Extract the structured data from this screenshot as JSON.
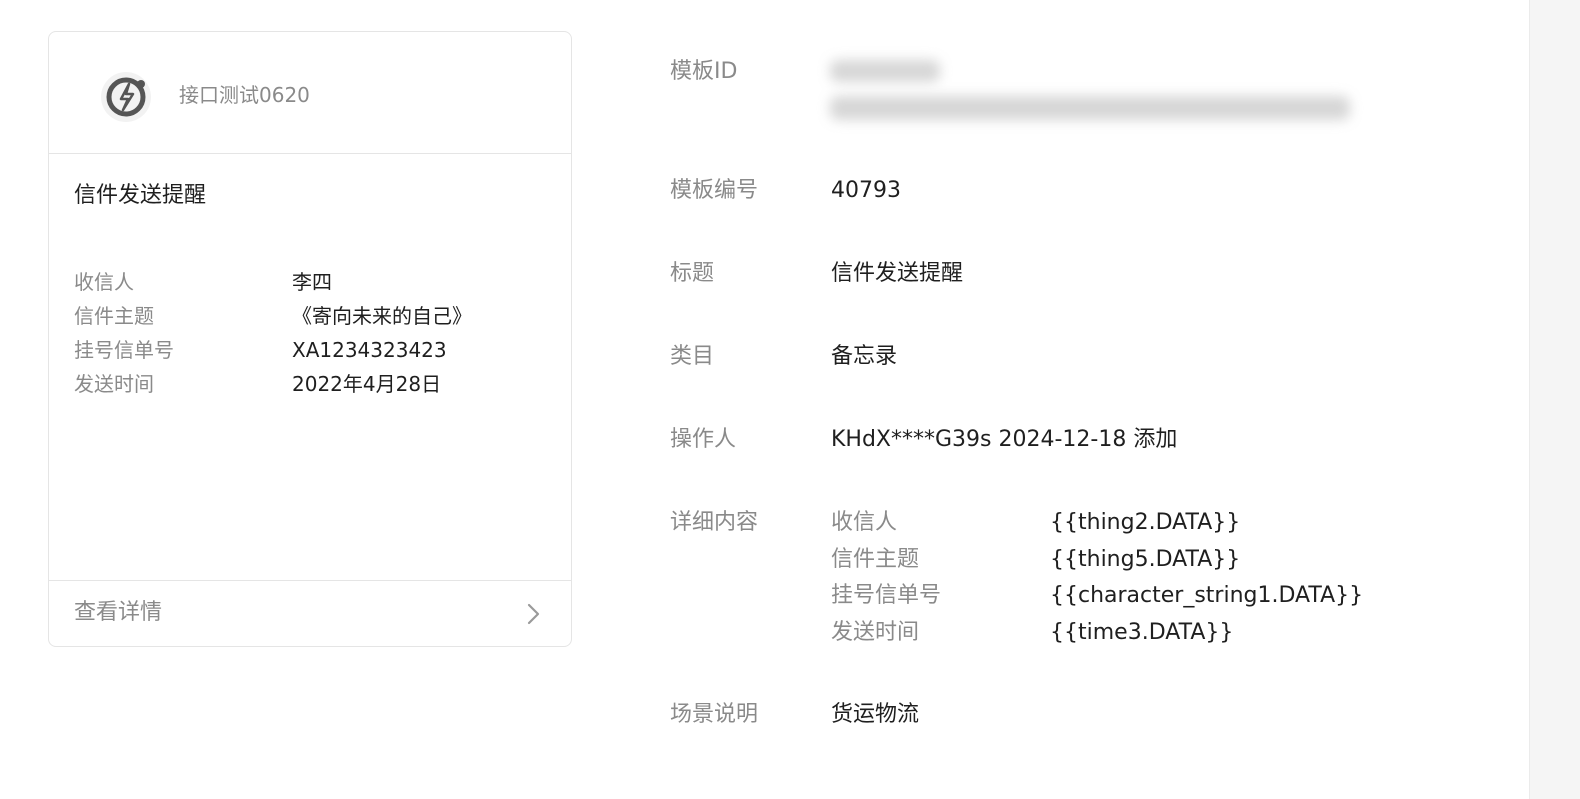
{
  "preview_card": {
    "account_name": "接口测试0620",
    "title": "信件发送提醒",
    "fields": [
      {
        "label": "收信人",
        "value": "李四"
      },
      {
        "label": "信件主题",
        "value": "《寄向未来的自己》"
      },
      {
        "label": "挂号信单号",
        "value": "XA1234323423"
      },
      {
        "label": "发送时间",
        "value": "2022年4月28日"
      }
    ],
    "footer_label": "查看详情",
    "logo_icon": "brand-logo-icon",
    "chevron_icon": "chevron-right-icon"
  },
  "details": {
    "template_id_label": "模板ID",
    "template_number_label": "模板编号",
    "template_number": "40793",
    "title_label": "标题",
    "title": "信件发送提醒",
    "category_label": "类目",
    "category": "备忘录",
    "operator_label": "操作人",
    "operator": "KHdX****G39s 2024-12-18 添加",
    "content_label": "详细内容",
    "content_fields": [
      {
        "label": "收信人",
        "value": "{{thing2.DATA}}"
      },
      {
        "label": "信件主题",
        "value": "{{thing5.DATA}}"
      },
      {
        "label": "挂号信单号",
        "value": "{{character_string1.DATA}}"
      },
      {
        "label": "发送时间",
        "value": "{{time3.DATA}}"
      }
    ],
    "scene_label": "场景说明",
    "scene": "货运物流"
  },
  "colors": {
    "label": "#8a8a8a",
    "value": "#1f1f1f",
    "border": "#e5e5e5",
    "side_strip": "#f5f5f5"
  }
}
